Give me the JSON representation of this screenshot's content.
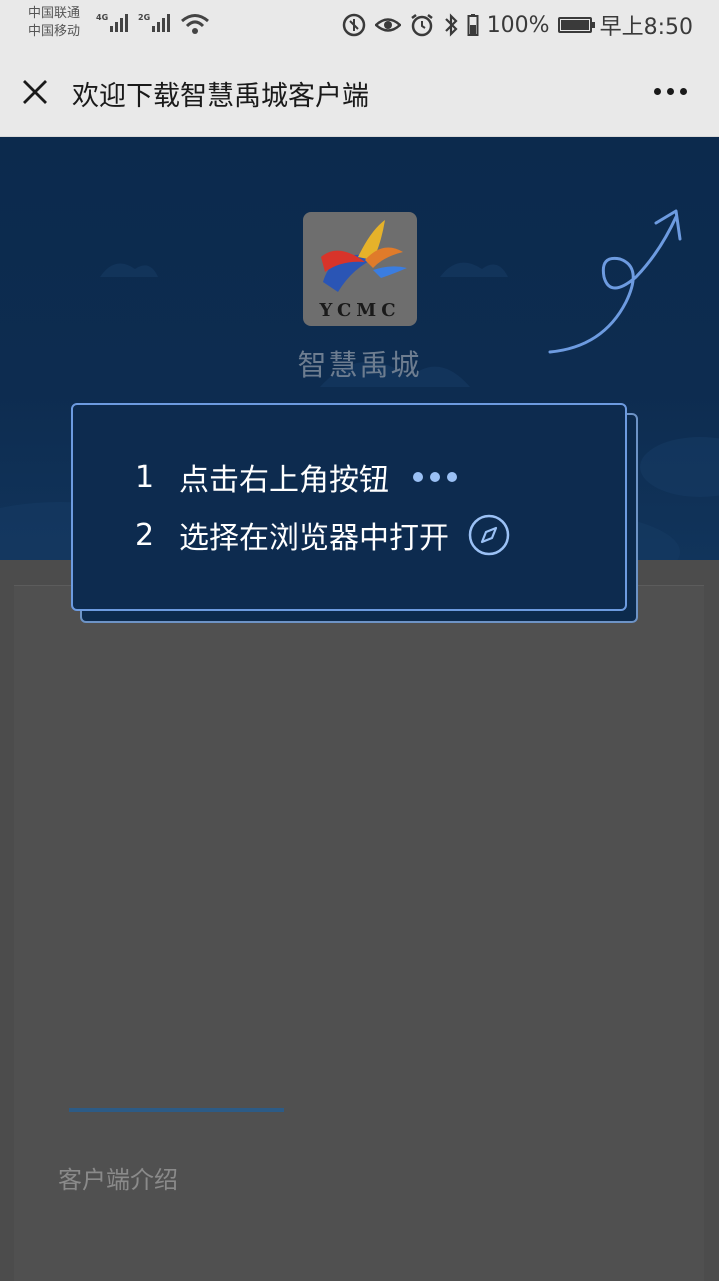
{
  "status_bar": {
    "carrier1": "中国联通",
    "carrier2": "中国移动",
    "net1": "4G",
    "net2": "2G",
    "battery_level": "100%",
    "time": "早上8:50"
  },
  "title_bar": {
    "title": "欢迎下载智慧禹城客户端"
  },
  "hero": {
    "logo_text": "YCMC",
    "app_name": "智慧禹城"
  },
  "guide": {
    "step1_num": "1",
    "step1_text": "点击右上角按钮",
    "step2_num": "2",
    "step2_text": "选择在浏览器中打开"
  },
  "content": {
    "intro_label": "客户端介绍"
  },
  "colors": {
    "hero_bg": "#0d2c50",
    "accent": "#6d9be0",
    "overlay": "#4c4c4c"
  }
}
